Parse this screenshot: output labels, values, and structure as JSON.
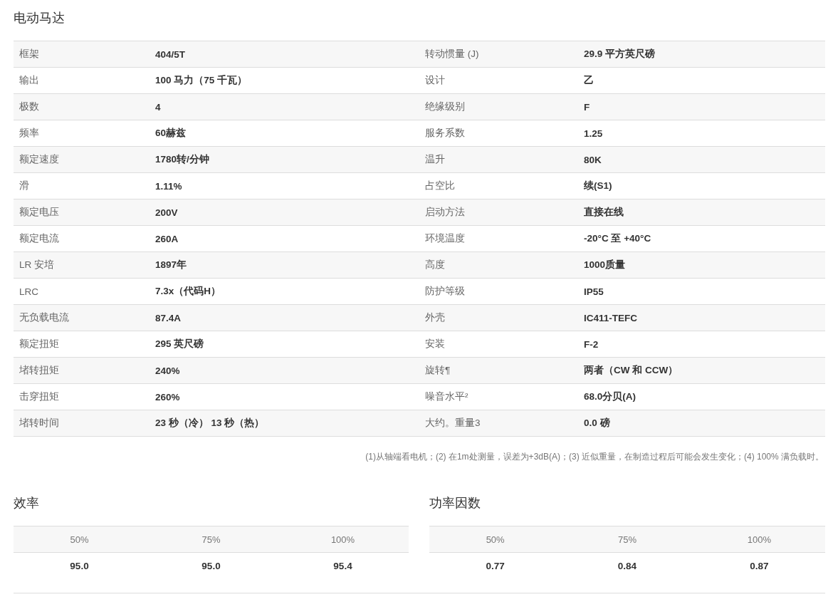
{
  "title": "电动马达",
  "specs": [
    {
      "label": "框架",
      "value": "404/5T",
      "label_2": "转动惯量 (J)",
      "value_2": "29.9 平方英尺磅"
    },
    {
      "label": "输出",
      "value": "100 马力（75 千瓦）",
      "label_2": "设计",
      "value_2": "乙"
    },
    {
      "label": "极数",
      "value": "4",
      "label_2": "绝缘级别",
      "value_2": "F"
    },
    {
      "label": "频率",
      "value": "60赫兹",
      "label_2": "服务系数",
      "value_2": "1.25"
    },
    {
      "label": "额定速度",
      "value": "1780转/分钟",
      "label_2": "温升",
      "value_2": "80K"
    },
    {
      "label": "滑",
      "value": "1.11%",
      "label_2": "占空比",
      "value_2": "续(S1)"
    },
    {
      "label": "额定电压",
      "value": "200V",
      "label_2": "启动方法",
      "value_2": "直接在线"
    },
    {
      "label": "额定电流",
      "value": "260A",
      "label_2": "环境温度",
      "value_2": "-20°C 至 +40°C"
    },
    {
      "label": "LR 安培",
      "value": "1897年",
      "label_2": "高度",
      "value_2": "1000质量"
    },
    {
      "label": "LRC",
      "value": "7.3x（代码H）",
      "label_2": "防护等级",
      "value_2": "IP55"
    },
    {
      "label": "无负载电流",
      "value": "87.4A",
      "label_2": "外壳",
      "value_2": "IC411-TEFC"
    },
    {
      "label": "额定扭矩",
      "value": "295 英尺磅",
      "label_2": "安装",
      "value_2": "F-2"
    },
    {
      "label": "堵转扭矩",
      "value": "240%",
      "label_2": "旋转¶",
      "value_2": "两者（CW 和 CCW）"
    },
    {
      "label": "击穿扭矩",
      "value": "260%",
      "label_2": "噪音水平²",
      "value_2": "68.0分贝(A)"
    },
    {
      "label": "堵转时间",
      "value": "23 秒（冷） 13 秒（热）",
      "label_2": "大约。重量3",
      "value_2": "0.0 磅"
    }
  ],
  "footnote": "(1)从轴端看电机；(2) 在1m处测量，误差为+3dB(A)；(3) 近似重量，在制造过程后可能会发生变化；(4) 100% 满负载时。",
  "load_tables": [
    {
      "title": "效率",
      "headers": [
        "50%",
        "75%",
        "100%"
      ],
      "values": [
        "95.0",
        "95.0",
        "95.4"
      ]
    },
    {
      "title": "功率因数",
      "headers": [
        "50%",
        "75%",
        "100%"
      ],
      "values": [
        "0.77",
        "0.84",
        "0.87"
      ]
    }
  ]
}
